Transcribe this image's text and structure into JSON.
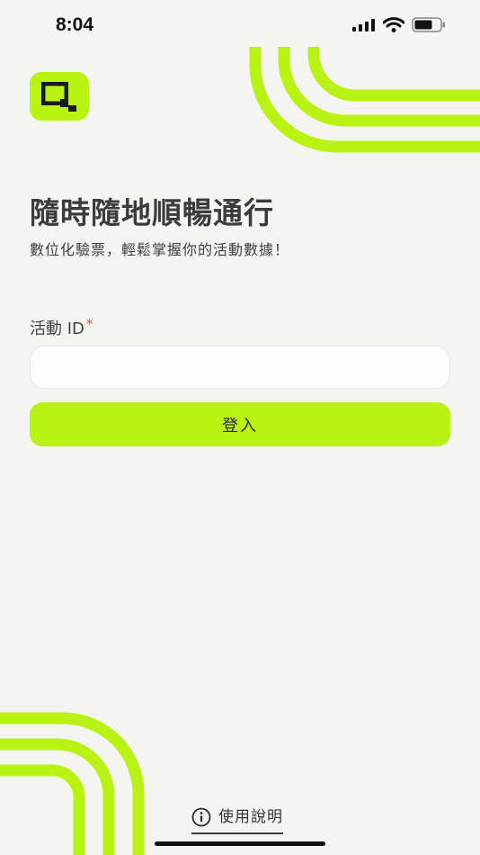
{
  "status_bar": {
    "time": "8:04",
    "signal_icon": "cellular-signal-icon",
    "wifi_icon": "wifi-icon",
    "battery_icon": "battery-icon"
  },
  "brand": {
    "logo_icon": "qr-logo-icon",
    "accent_color": "#b8f314",
    "logo_mark_color": "#1a1a1a"
  },
  "hero": {
    "headline": "隨時隨地順暢通行",
    "subtitle": "數位化驗票，輕鬆掌握你的活動數據！"
  },
  "form": {
    "event_id_label": "活動 ID",
    "required_mark": "*",
    "event_id_value": "",
    "event_id_placeholder": "",
    "login_button_label": "登入"
  },
  "footer": {
    "help_icon": "info-icon",
    "help_label": "使用說明"
  }
}
